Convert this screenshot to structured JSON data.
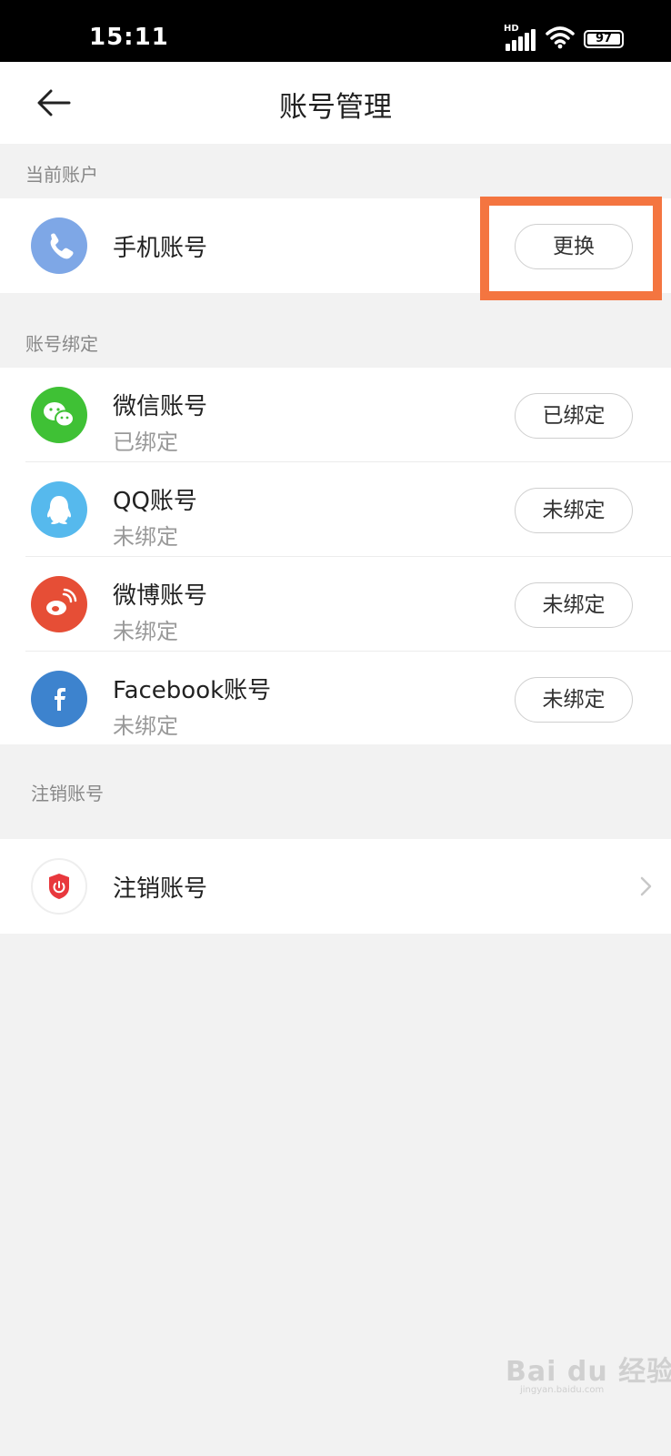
{
  "status_bar": {
    "time": "15:11",
    "network": "HD",
    "battery": "97"
  },
  "header": {
    "title": "账号管理"
  },
  "current_account": {
    "section_label": "当前账户",
    "item": {
      "title": "手机账号",
      "action": "更换",
      "icon": "phone-icon",
      "color": "#7ea7e6"
    }
  },
  "bindings": {
    "section_label": "账号绑定",
    "items": [
      {
        "title": "微信账号",
        "status": "已绑定",
        "action": "已绑定",
        "icon": "wechat-icon",
        "color": "#3fc135"
      },
      {
        "title": "QQ账号",
        "status": "未绑定",
        "action": "未绑定",
        "icon": "qq-icon",
        "color": "#56b9ed"
      },
      {
        "title": "微博账号",
        "status": "未绑定",
        "action": "未绑定",
        "icon": "weibo-icon",
        "color": "#e64e36"
      },
      {
        "title": "Facebook账号",
        "status": "未绑定",
        "action": "未绑定",
        "icon": "facebook-icon",
        "color": "#3d83ce"
      }
    ]
  },
  "cancel_account": {
    "section_label": "注销账号",
    "item": {
      "title": "注销账号",
      "icon": "shield-power-icon",
      "color": "#e8383d"
    }
  },
  "watermark": {
    "text": "Bai du 经验",
    "sub": "jingyan.baidu.com"
  },
  "colors": {
    "highlight": "#f47540",
    "background": "#f2f2f2"
  }
}
